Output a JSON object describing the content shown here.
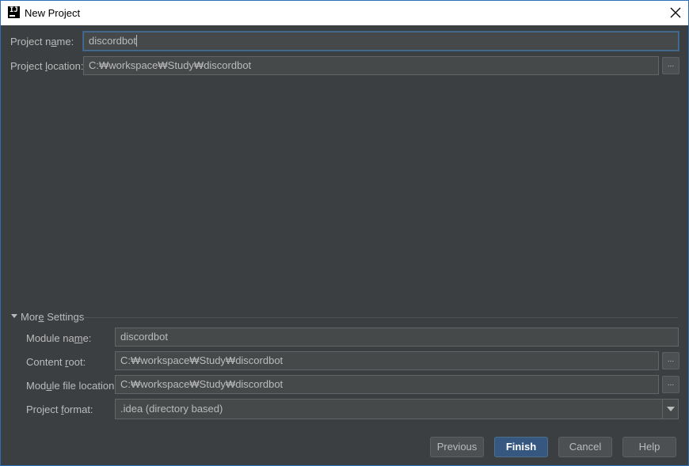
{
  "window": {
    "title": "New Project",
    "app_icon_text": "IJ"
  },
  "project": {
    "name_label_pre": "Project n",
    "name_label_u": "a",
    "name_label_post": "me:",
    "name_value": "discordbot",
    "location_label_pre": "Project ",
    "location_label_u": "l",
    "location_label_post": "ocation:",
    "location_value": "C:₩workspace₩Study₩discordbot",
    "browse_label": "..."
  },
  "more_settings": {
    "header_pre": "Mor",
    "header_u": "e",
    "header_post": " Settings",
    "module_name_label_pre": "Module na",
    "module_name_label_u": "m",
    "module_name_label_post": "e:",
    "module_name_value": "discordbot",
    "content_root_label_pre": "Content ",
    "content_root_label_u": "r",
    "content_root_label_post": "oot:",
    "content_root_value": "C:₩workspace₩Study₩discordbot",
    "module_file_label_pre": "Mod",
    "module_file_label_u": "u",
    "module_file_label_post": "le file location:",
    "module_file_value": "C:₩workspace₩Study₩discordbot",
    "format_label_pre": "Project ",
    "format_label_u": "f",
    "format_label_post": "ormat:",
    "format_value": ".idea (directory based)",
    "browse_label": "..."
  },
  "buttons": {
    "previous": "Previous",
    "finish": "Finish",
    "cancel": "Cancel",
    "help": "Help"
  },
  "colors": {
    "background": "#3c3f41",
    "field": "#45494a",
    "primary_button": "#365880",
    "focus": "#466d94"
  }
}
